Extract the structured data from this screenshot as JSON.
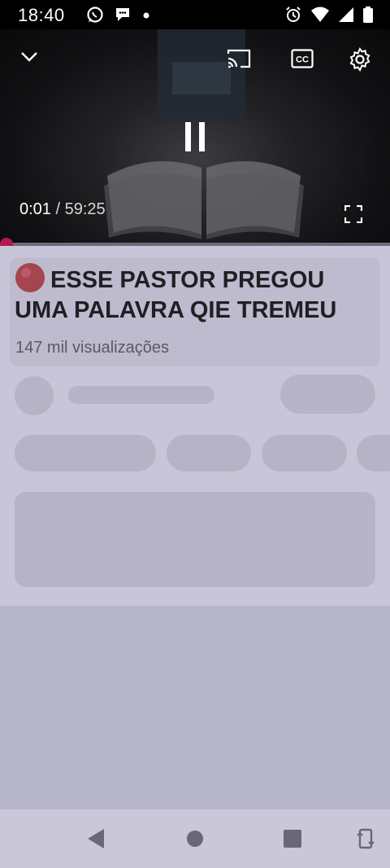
{
  "status_bar": {
    "time": "18:40",
    "left_icons": [
      "whatsapp-icon",
      "chat-bubble-icon",
      "dot-icon"
    ],
    "right_icons": [
      "alarm-icon",
      "wifi-icon",
      "signal-icon",
      "battery-icon"
    ]
  },
  "player": {
    "current_time": "0:01",
    "separator": "/",
    "duration": "59:25",
    "progress": 0.0003,
    "controls": [
      "collapse-chevron-icon",
      "cast-icon",
      "captions-icon",
      "settings-gear-icon",
      "pause-icon",
      "fullscreen-icon"
    ],
    "accent_color": "#b4184e"
  },
  "video": {
    "title": "ESSE PASTOR PREGOU UMA PALAVRA QIE TREMEU",
    "views": "147 mil visualizações"
  },
  "nav_bar": {
    "buttons": [
      "back-icon",
      "home-icon",
      "recents-icon",
      "rotate-icon"
    ]
  }
}
